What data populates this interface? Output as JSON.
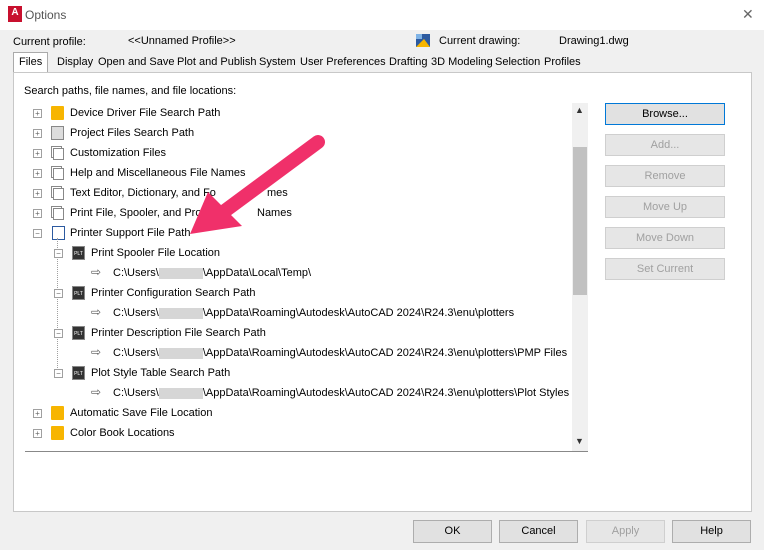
{
  "window": {
    "title": "Options",
    "app_icon": "A"
  },
  "profile": {
    "label": "Current profile:",
    "value": "<<Unnamed Profile>>"
  },
  "drawing": {
    "label": "Current drawing:",
    "value": "Drawing1.dwg"
  },
  "tabs": [
    "Files",
    "Display",
    "Open and Save",
    "Plot and Publish",
    "System",
    "User Preferences",
    "Drafting",
    "3D Modeling",
    "Selection",
    "Profiles"
  ],
  "active_tab": "Files",
  "search_label": "Search paths, file names, and file locations:",
  "tree": [
    {
      "label": "Device Driver File Search Path",
      "icon": "folder-icon"
    },
    {
      "label": "Project Files Search Path",
      "icon": "project-files-icon"
    },
    {
      "label": "Customization Files",
      "icon": "multi-doc-icon"
    },
    {
      "label": "Help and Miscellaneous File Names",
      "icon": "multi-doc-icon"
    },
    {
      "label": "Text Editor, Dictionary, and Fo",
      "suffix": "mes",
      "icon": "multi-doc-icon"
    },
    {
      "label": "Print File, Spooler, and Prolo",
      "suffix": "Names",
      "icon": "multi-doc-icon"
    },
    {
      "label": "Printer Support File Path",
      "icon": "doc-icon"
    },
    {
      "label": "Print Spooler File Location",
      "icon": "plt-icon"
    },
    {
      "path_prefix": "C:\\Users\\",
      "path_suffix": "\\AppData\\Local\\Temp\\"
    },
    {
      "label": "Printer Configuration Search Path",
      "icon": "plt-icon"
    },
    {
      "path_prefix": "C:\\Users\\",
      "path_suffix": "\\AppData\\Roaming\\Autodesk\\AutoCAD 2024\\R24.3\\enu\\plotters"
    },
    {
      "label": "Printer Description File Search Path",
      "icon": "plt-icon"
    },
    {
      "path_prefix": "C:\\Users\\",
      "path_suffix": "\\AppData\\Roaming\\Autodesk\\AutoCAD 2024\\R24.3\\enu\\plotters\\PMP Files"
    },
    {
      "label": "Plot Style Table Search Path",
      "icon": "plt-icon"
    },
    {
      "path_prefix": "C:\\Users\\",
      "path_suffix": "\\AppData\\Roaming\\Autodesk\\AutoCAD 2024\\R24.3\\enu\\plotters\\Plot Styles"
    },
    {
      "label": "Automatic Save File Location",
      "icon": "folder-icon"
    },
    {
      "label": "Color Book Locations",
      "icon": "folder-icon"
    }
  ],
  "side_buttons": {
    "browse": "Browse...",
    "add": "Add...",
    "remove": "Remove",
    "move_up": "Move Up",
    "move_down": "Move Down",
    "set_current": "Set Current"
  },
  "bottom_buttons": {
    "ok": "OK",
    "cancel": "Cancel",
    "apply": "Apply",
    "help": "Help"
  },
  "colors": {
    "pointer_arrow": "#f0306a",
    "folder": "#f7b500",
    "app_icon": "#c8102e"
  }
}
